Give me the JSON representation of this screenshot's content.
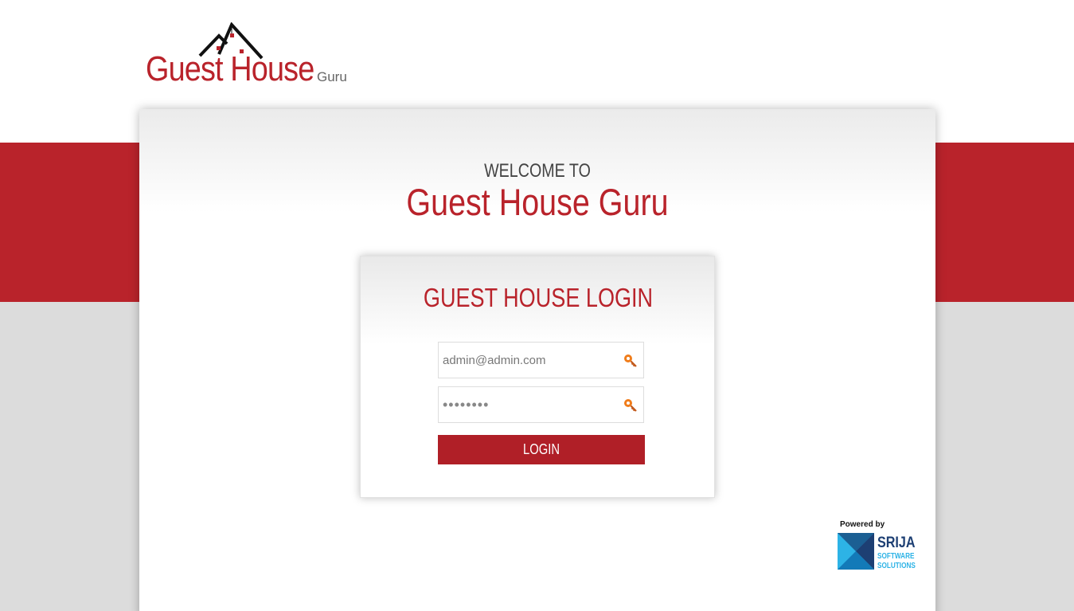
{
  "logo": {
    "main_text": "Guest House",
    "sub_text": "Guru"
  },
  "welcome": {
    "line1": "WELCOME TO",
    "title": "Guest House Guru"
  },
  "login": {
    "title": "GUEST HOUSE LOGIN",
    "email_value": "admin@admin.com",
    "password_value": "12345678",
    "button_label": "LOGIN"
  },
  "footer": {
    "powered_label": "Powered by",
    "company_name": "SRIJA",
    "company_line1": "SOFTWARE",
    "company_line2": "SOLUTIONS"
  },
  "colors": {
    "brand_red": "#b9232b",
    "button_red": "#b01f27",
    "grey_band": "#dcdcdc",
    "key_orange": "#f07c1a"
  },
  "icons": {
    "email_field": "key-icon",
    "password_field": "key-icon",
    "logo": "roof-icon"
  }
}
